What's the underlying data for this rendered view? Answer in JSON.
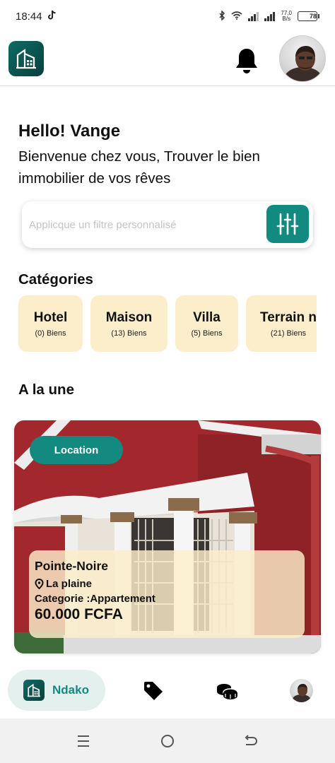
{
  "status_bar": {
    "time": "18:44",
    "speed_value": "77,0",
    "speed_unit": "B/s",
    "battery_level": "78",
    "battery_fraction": 0.78,
    "icons": [
      "tiktok-icon",
      "bluetooth-icon",
      "wifi-icon",
      "signal-icon",
      "signal-icon",
      "battery-icon"
    ]
  },
  "header": {
    "logo_icon": "building-logo-icon",
    "notification_icon": "bell-icon",
    "profile_icon": "user-avatar"
  },
  "greeting": {
    "title": "Hello! Vange",
    "subtitle": "Bienvenue chez vous, Trouver le bien immobilier de vos rêves"
  },
  "search": {
    "placeholder": "Applicque un filtre personnalisé",
    "value": "",
    "filter_icon": "sliders-icon"
  },
  "categories": {
    "title": "Catégories",
    "items": [
      {
        "name": "Hotel",
        "count": "(0) Biens"
      },
      {
        "name": "Maison",
        "count": "(13) Biens"
      },
      {
        "name": "Villa",
        "count": "(5) Biens"
      },
      {
        "name": "Terrain n",
        "count": "(21) Biens"
      }
    ]
  },
  "featured": {
    "title": "A la une",
    "badge": "Location",
    "city": "Pointe-Noire",
    "location": "La plaine",
    "location_icon": "map-pin-icon",
    "category": "Categorie :Appartement",
    "price": "60.000 FCFA"
  },
  "bottom_nav": {
    "home_label": "Ndako",
    "items": [
      "home-logo-icon",
      "price-tag-icon",
      "coins-icon",
      "profile-avatar"
    ]
  },
  "system_nav": {
    "items": [
      "menu-icon",
      "home-circle-icon",
      "back-icon"
    ]
  },
  "colors": {
    "accent": "#138a80",
    "logo_dark": "#0a3f3d",
    "category_bg": "#fdeecb",
    "nav_active_bg": "#e3f0ee"
  }
}
